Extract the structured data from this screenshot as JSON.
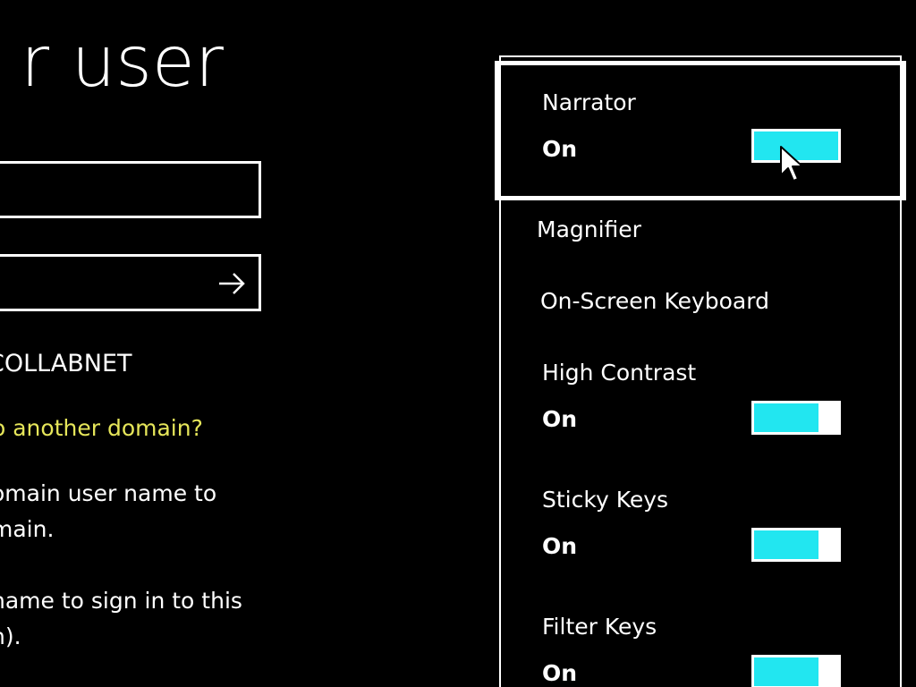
{
  "signin": {
    "title": "r user",
    "username_value": "",
    "password_value": "",
    "domain_text": "COLLABNET",
    "domain_link": "o another domain?",
    "help_1_line_1": "omain user name to",
    "help_1_line_2": "main.",
    "help_2_line_1": "name to sign in to this",
    "help_2_line_2": "n)."
  },
  "ease_of_access": {
    "items": [
      {
        "label": "Narrator",
        "state": "On",
        "toggle_on": true,
        "focused": true
      },
      {
        "label": "Magnifier"
      },
      {
        "label": "On-Screen Keyboard"
      },
      {
        "label": "High Contrast",
        "state": "On",
        "toggle_on": true
      },
      {
        "label": "Sticky Keys",
        "state": "On",
        "toggle_on": true
      },
      {
        "label": "Filter Keys",
        "state": "On",
        "toggle_on": true
      }
    ]
  },
  "colors": {
    "background": "#000000",
    "text": "#ffffff",
    "link": "#e6e65a",
    "toggle_on": "#22e6f0"
  },
  "icons": {
    "submit": "arrow-right-icon",
    "pointer": "cursor-icon"
  }
}
